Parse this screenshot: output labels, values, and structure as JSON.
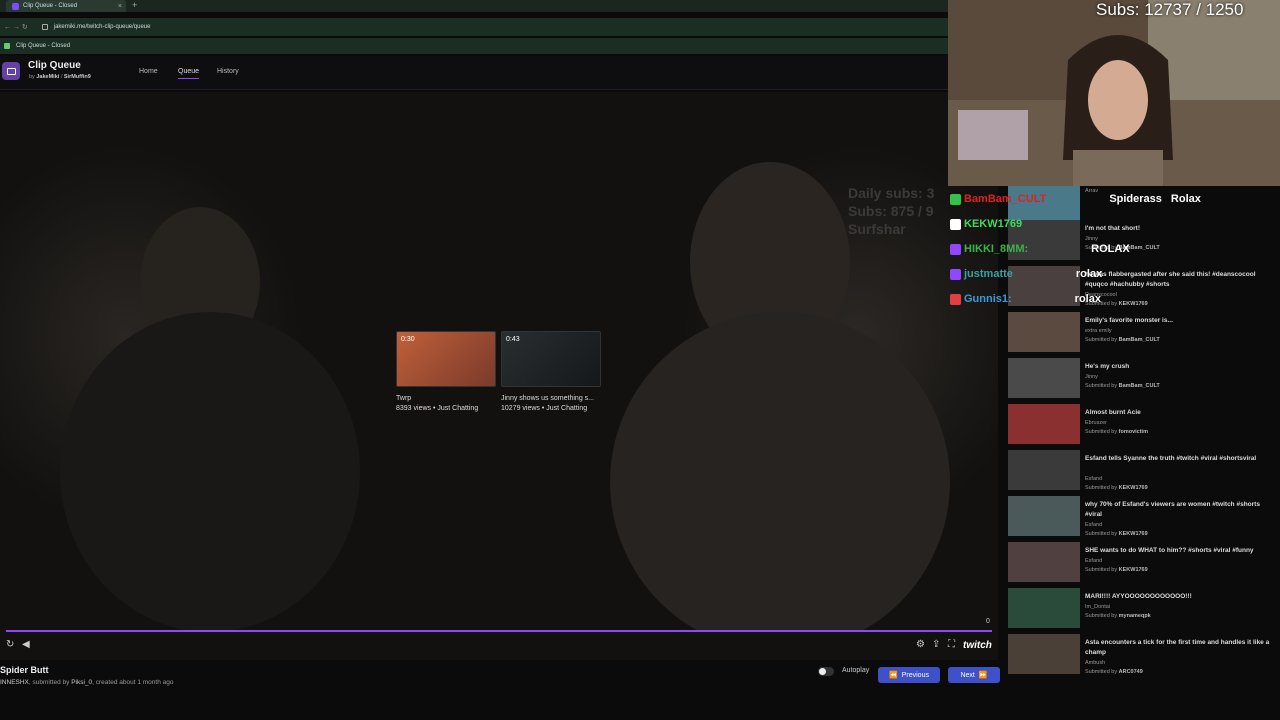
{
  "browser": {
    "tab_title": "Clip Queue - Closed",
    "new_tab": "+",
    "url": "jakemiki.me/twitch-clip-queue/queue",
    "bookmark": "Clip Queue - Closed"
  },
  "app": {
    "title": "Clip Queue",
    "by_prefix": "by",
    "author1": "JakeMiki",
    "separator": "/",
    "author2": "SirMuffin9",
    "nav": [
      "Home",
      "Queue",
      "History"
    ]
  },
  "player": {
    "watermark_line1": "Daily subs: 3",
    "watermark_line2": "Subs: 875 / 9",
    "watermark_line3": "Surfshar",
    "thumbs": [
      {
        "duration": "0:30",
        "title": "Twrp",
        "meta": "8393 views • Just Chatting"
      },
      {
        "duration": "0:43",
        "title": "Jinny shows us something s...",
        "meta": "10279 views • Just Chatting"
      }
    ],
    "counter": "0",
    "progress": 1.0,
    "brand": "twitch"
  },
  "clip": {
    "title": "Spider Butt",
    "channel": "INNESHX",
    "submitted_prefix": ", submitted by",
    "submitter": "Piksi_0",
    "created": ", created about 1 month ago"
  },
  "controls": {
    "autoplay_label": "Autoplay",
    "autoplay_on": false,
    "previous_label": "Previous",
    "next_label": "Next"
  },
  "stream": {
    "subs_counter": "Subs: 12737 / 1250"
  },
  "chat": [
    {
      "user": "BamBam_CULT",
      "user_color": "#e02020",
      "message": "Spiderass",
      "message2": "Rolax"
    },
    {
      "user": "KEKW1769",
      "user_color": "#3ddc5a",
      "message": "",
      "message2": ""
    },
    {
      "user": "HIKKI_8MM:",
      "user_color": "#3cb34a",
      "message": "ROLAX",
      "message2": ""
    },
    {
      "user": "justmatte",
      "user_color": "#3aa0a0",
      "message": "rolax",
      "message2": ""
    },
    {
      "user": "Gunnis1:",
      "user_color": "#3a9bd9",
      "message": "rolax",
      "message2": ""
    }
  ],
  "queue": [
    {
      "title": "",
      "channel": "Arrav",
      "submitter": "",
      "thumb_color": "#4a7a8a"
    },
    {
      "title": "I'm not that short!",
      "channel": "Jinny",
      "submitter": "BamBam_CULT",
      "thumb_color": "#3a3a3a"
    },
    {
      "title": "he was flabbergasted after she said this! #deanscocool #quqco #hachubby #shorts",
      "channel": "Deanscocool",
      "submitter": "KEKW1769",
      "thumb_color": "#4a4040"
    },
    {
      "title": "Emily's favorite monster is...",
      "channel": "extra emily",
      "submitter": "BamBam_CULT",
      "thumb_color": "#5a4a40"
    },
    {
      "title": "He's my crush",
      "channel": "Jinny",
      "submitter": "BamBam_CULT",
      "thumb_color": "#4a4a4a"
    },
    {
      "title": "Almost burnt Acie",
      "channel": "Ebruszer",
      "submitter": "fomovictim",
      "thumb_color": "#8a3030"
    },
    {
      "title": "Esfand tells Syanne the truth #twitch #viral #shortsviral",
      "channel": "Esfand",
      "submitter": "KEKW1769",
      "thumb_color": "#3a3a3a"
    },
    {
      "title": "why 70% of Esfand's viewers are women #twitch #shorts #viral",
      "channel": "Esfand",
      "submitter": "KEKW1769",
      "thumb_color": "#4a5a5a"
    },
    {
      "title": "SHE wants to do WHAT to him?? #shorts #viral #funny",
      "channel": "Esfand",
      "submitter": "KEKW1769",
      "thumb_color": "#504040"
    },
    {
      "title": "MARI!!!! AYYOOOOOOOOOOOO!!!",
      "channel": "Im_Dontai",
      "submitter": "mynameqpk",
      "thumb_color": "#2a4a3a"
    },
    {
      "title": "Asta encounters a tick for the first time and handles it like a champ",
      "channel": "Ambush",
      "submitter": "ARC0749",
      "thumb_color": "#4a4038"
    }
  ],
  "queue_submitted_prefix": "Submitted by"
}
